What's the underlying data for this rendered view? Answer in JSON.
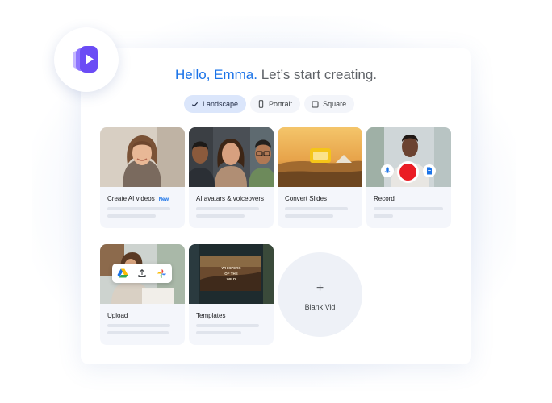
{
  "greeting": {
    "hello": "Hello, Emma.",
    "rest": "Let’s start creating."
  },
  "tabs": [
    {
      "label": "Landscape",
      "active": true,
      "icon": "check-icon"
    },
    {
      "label": "Portrait",
      "active": false,
      "icon": "portrait-icon"
    },
    {
      "label": "Square",
      "active": false,
      "icon": "square-icon"
    }
  ],
  "cards": {
    "create_ai": {
      "label": "Create AI videos",
      "badge": "New"
    },
    "avatars": {
      "label": "AI avatars & voiceovers"
    },
    "slides": {
      "label": "Convert Slides"
    },
    "record": {
      "label": "Record"
    },
    "upload": {
      "label": "Upload"
    },
    "templates": {
      "label": "Templates",
      "thumb_text": "WHISPERS OF THE WILD"
    }
  },
  "blank": {
    "plus": "+",
    "label": "Blank Vid"
  },
  "colors": {
    "accent": "#1a73e8",
    "record_red": "#ea1c24",
    "logo_purple": "#6b4cf5"
  }
}
